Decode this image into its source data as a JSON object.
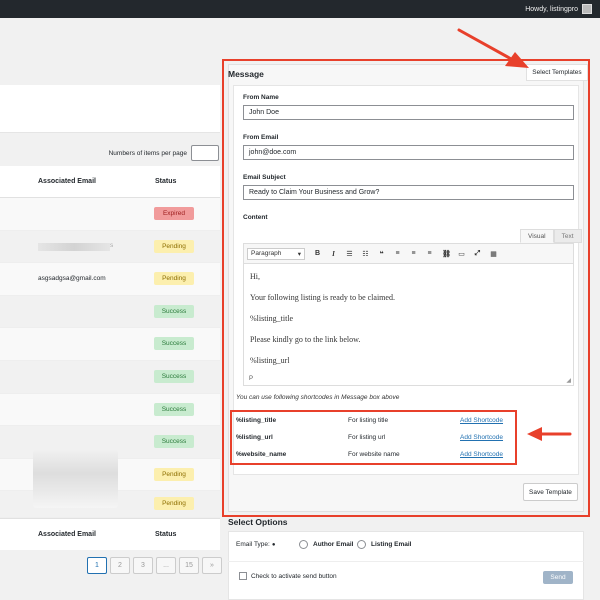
{
  "colors": {
    "accent": "#e8402b",
    "link": "#2271b1",
    "adminbar": "#23282d"
  },
  "adminbar": {
    "greeting": "Howdy, listingpro"
  },
  "list": {
    "per_page_label": "Numbers of items per page",
    "col_email": "Associated Email",
    "col_status": "Status",
    "rows": [
      {
        "email": "",
        "status": "Expired"
      },
      {
        "email": "s",
        "status": "Pending"
      },
      {
        "email": "asgsadgsa@gmail.com",
        "status": "Pending"
      },
      {
        "email": "",
        "status": "Success"
      },
      {
        "email": "",
        "status": "Success"
      },
      {
        "email": "",
        "status": "Success"
      },
      {
        "email": "",
        "status": "Success"
      },
      {
        "email": "",
        "status": "Success"
      },
      {
        "email": "",
        "status": "Pending"
      },
      {
        "email": "",
        "status": "Pending"
      }
    ],
    "pagination": [
      "1",
      "2",
      "3",
      "...",
      "15",
      "»"
    ]
  },
  "message": {
    "title": "Message",
    "select_templates": "Select Templates",
    "from_name_label": "From Name",
    "from_name_value": "John Doe",
    "from_email_label": "From Email",
    "from_email_value": "john@doe.com",
    "subject_label": "Email Subject",
    "subject_value": "Ready to Claim Your Business and Grow?",
    "content_label": "Content",
    "tab_visual": "Visual",
    "tab_text": "Text",
    "format_select": "Paragraph",
    "toolbar_icons": [
      "bold-icon",
      "italic-icon",
      "bullet-list-icon",
      "numbered-list-icon",
      "blockquote-icon",
      "align-left-icon",
      "align-center-icon",
      "align-right-icon",
      "link-icon",
      "read-more-icon",
      "fullscreen-icon",
      "toolbar-toggle-icon"
    ],
    "body_lines": [
      "Hi,",
      "Your following listing is ready to be claimed.",
      "%listing_title",
      "Please kindly go to the link below.",
      "%listing_url"
    ],
    "editor_status": "P",
    "hint": "You can use following shortcodes in Message box above",
    "shortcodes": [
      {
        "code": "%listing_title",
        "desc": "For listing title",
        "link": "Add Shortcode"
      },
      {
        "code": "%listing_url",
        "desc": "For listing url",
        "link": "Add Shortcode"
      },
      {
        "code": "%website_name",
        "desc": "For website name",
        "link": "Add Shortcode"
      }
    ],
    "save_template": "Save Template"
  },
  "options": {
    "title": "Select Options",
    "email_type_label": "Email Type:",
    "author_email": "Author Email",
    "listing_email": "Listing Email",
    "checkbox_label": "Check to activate send button",
    "send": "Send"
  }
}
